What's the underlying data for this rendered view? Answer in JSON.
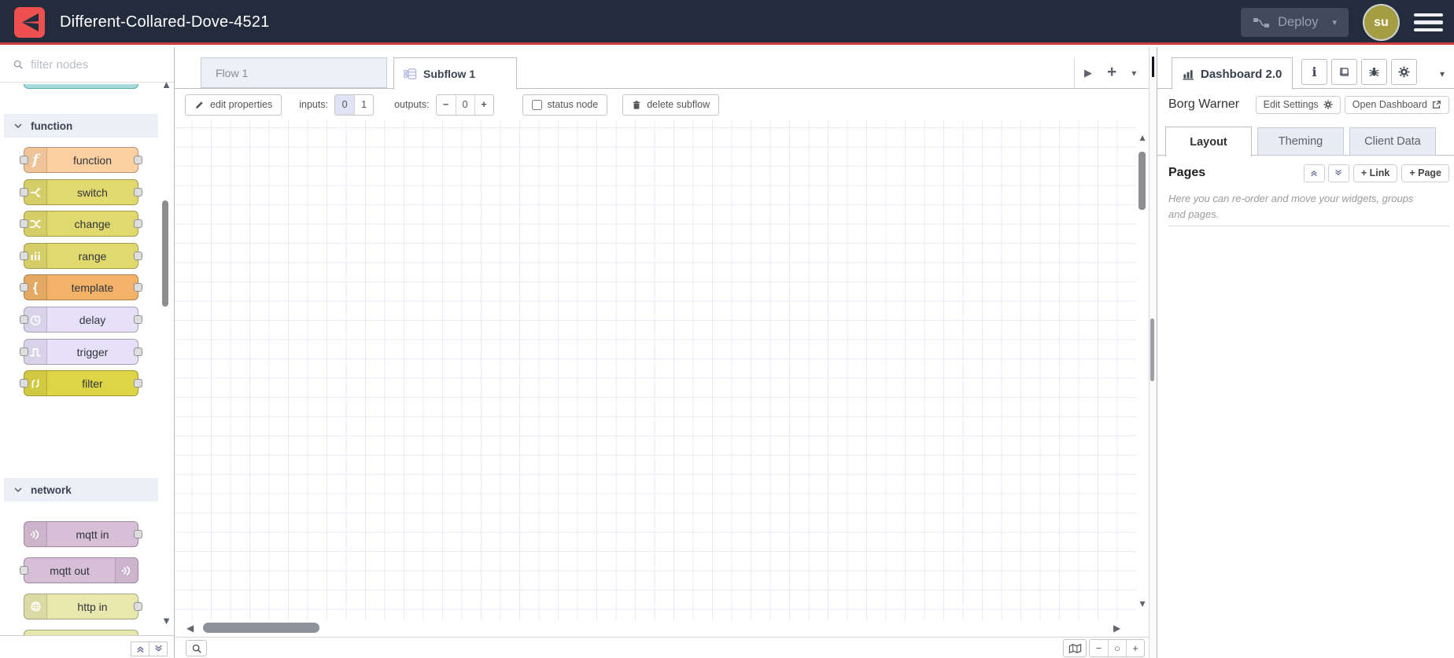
{
  "header": {
    "title": "Different-Collared-Dove-4521",
    "deploy_label": "Deploy",
    "avatar": "su"
  },
  "palette": {
    "search_placeholder": "filter nodes",
    "categories": [
      {
        "label": "function",
        "nodes": [
          {
            "label": "function",
            "color": "#fdd0a2",
            "icon": "function-icon",
            "ports": "both"
          },
          {
            "label": "switch",
            "color": "#e2d96e",
            "icon": "switch-icon",
            "ports": "both"
          },
          {
            "label": "change",
            "color": "#e2d96e",
            "icon": "change-icon",
            "ports": "both"
          },
          {
            "label": "range",
            "color": "#e2d96e",
            "icon": "range-icon",
            "ports": "both"
          },
          {
            "label": "template",
            "color": "#f2b368",
            "icon": "template-icon",
            "ports": "both"
          },
          {
            "label": "delay",
            "color": "#e6e0f8",
            "icon": "delay-icon",
            "ports": "both"
          },
          {
            "label": "trigger",
            "color": "#e6e0f8",
            "icon": "trigger-icon",
            "ports": "both"
          },
          {
            "label": "filter",
            "color": "#ddd545",
            "icon": "filter-icon",
            "ports": "both"
          }
        ]
      },
      {
        "label": "network",
        "nodes": [
          {
            "label": "mqtt in",
            "color": "#d8bfd8",
            "icon": "mqtt-icon",
            "ports": "out"
          },
          {
            "label": "mqtt out",
            "color": "#d8bfd8",
            "icon": "mqtt-icon",
            "ports": "in",
            "icon_side": "right"
          },
          {
            "label": "http in",
            "color": "#e7e7ae",
            "icon": "globe-icon",
            "ports": "out"
          }
        ]
      }
    ],
    "partial_nodes": [
      {
        "position": "top",
        "color": "#a8dcdc"
      },
      {
        "position": "bottom",
        "color": "#e7e7ae"
      }
    ]
  },
  "workspace": {
    "tabs": [
      {
        "label": "Flow 1",
        "active": false,
        "icon": null
      },
      {
        "label": "Subflow 1",
        "active": true,
        "icon": "subflow-icon"
      }
    ],
    "toolbar": {
      "edit_properties": "edit properties",
      "inputs_label": "inputs:",
      "inputs_options": [
        "0",
        "1"
      ],
      "inputs_selected": "0",
      "outputs_label": "outputs:",
      "outputs_minus": "−",
      "outputs_value": "0",
      "outputs_plus": "+",
      "status_node": "status node",
      "delete_subflow": "delete subflow"
    },
    "footer": {
      "zoom_out": "−",
      "zoom_reset": "○",
      "zoom_in": "+"
    }
  },
  "sidebar": {
    "active_tab": "Dashboard 2.0",
    "tool_buttons": [
      "info-icon",
      "book-icon",
      "bug-icon",
      "gear-icon"
    ],
    "instance_name": "Borg Warner",
    "edit_settings_label": "Edit Settings",
    "open_dashboard_label": "Open Dashboard",
    "tabs": [
      {
        "label": "Layout",
        "active": true
      },
      {
        "label": "Theming",
        "active": false
      },
      {
        "label": "Client Data",
        "active": false
      }
    ],
    "pages": {
      "title": "Pages",
      "link_label": "+ Link",
      "page_label": "+ Page",
      "help_text": "Here you can re-order and move your widgets, groups and pages."
    }
  },
  "colors": {
    "header_bg": "#232c3d",
    "accent_red": "#d23c3c",
    "logo_red": "#ee4f4f",
    "avatar_bg": "#a59d42",
    "grid_line": "#e8eaf5"
  }
}
